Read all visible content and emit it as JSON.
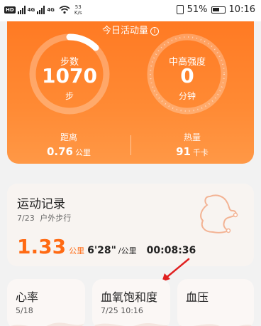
{
  "status_bar": {
    "hd": "HD",
    "signal_1": "4G",
    "signal_2": "4G",
    "net_speed_value": "53",
    "net_speed_unit": "K/s",
    "battery_percent": "51%",
    "time": "10:16"
  },
  "activity": {
    "title": "今日活动量",
    "info_glyph": "i",
    "steps": {
      "label": "步数",
      "value": "1070",
      "unit": "步"
    },
    "intensity": {
      "label": "中高强度",
      "value": "0",
      "unit": "分钟"
    },
    "distance": {
      "label": "距离",
      "value": "0.76",
      "unit": "公里"
    },
    "calories": {
      "label": "热量",
      "value": "91",
      "unit": "千卡"
    }
  },
  "exercise_record": {
    "title": "运动记录",
    "date": "7/23",
    "type": "户外步行",
    "distance": "1.33",
    "distance_unit": "公里",
    "pace": "6'28\"",
    "pace_unit": "/公里",
    "duration": "00:08:36"
  },
  "metrics": {
    "heart_rate": {
      "title": "心率",
      "date": "5/18"
    },
    "blood_oxygen": {
      "title": "血氧饱和度",
      "date": "7/25 10:16"
    },
    "blood_pressure": {
      "title": "血压"
    }
  },
  "colors": {
    "accent_orange": "#ff7a23",
    "annotation_arrow": "#e02020"
  }
}
